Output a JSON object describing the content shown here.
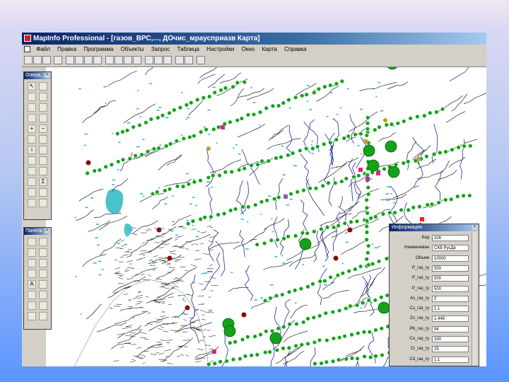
{
  "app": {
    "title": "MapInfo Professional - [газов_ВРС,..., ДОчис_мраусприазв Карта]"
  },
  "menu": [
    "Файл",
    "Правка",
    "Программа",
    "Объекты",
    "Запрос",
    "Таблица",
    "Настройки",
    "Окно",
    "Карта",
    "Справка"
  ],
  "palettes": {
    "operations_title": "Опера...",
    "panel_title": "Панель",
    "text_tool_label": "A"
  },
  "info": {
    "title": "Информация",
    "rows": [
      {
        "label": "Код",
        "value": "326"
      },
      {
        "label": "Наименован",
        "value": "СКВ РусДв"
      },
      {
        "label": "Объем",
        "value": "10000"
      },
      {
        "label": "P_газ_гу",
        "value": "500"
      },
      {
        "label": "P_газ_гу",
        "value": "500"
      },
      {
        "label": "P_газ_гу",
        "value": "500"
      },
      {
        "label": "As_газ_гу",
        "value": "0"
      },
      {
        "label": "Cu_газ_гу",
        "value": "1.1"
      },
      {
        "label": "Zn_газ_гу",
        "value": "1.448"
      },
      {
        "label": "Pb_газ_гу",
        "value": "94"
      },
      {
        "label": "Co_газ_гу",
        "value": "330"
      },
      {
        "label": "Cr_газ_гу",
        "value": "25"
      },
      {
        "label": "Cd_газ_гу",
        "value": "1.1"
      }
    ]
  },
  "colors": {
    "window_bg": "#d4d0c8",
    "map_lines": "#000000",
    "rivers": "#1f2a8a",
    "lakes": "#29b8c0",
    "green_marker": "#12a31a",
    "dark_red_marker": "#8a0a0a",
    "magenta_marker": "#e0208c",
    "olive_marker": "#b8a020",
    "red_marker": "#ff1a1a"
  }
}
